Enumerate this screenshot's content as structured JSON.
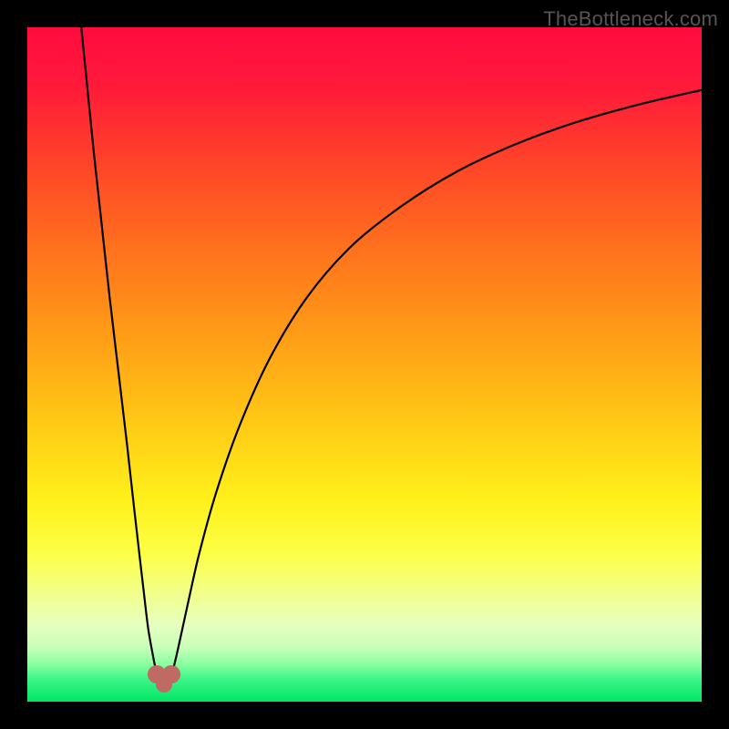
{
  "watermark": {
    "text": "TheBottleneck.com"
  },
  "chart_data": {
    "type": "line",
    "title": "",
    "xlabel": "",
    "ylabel": "",
    "xlim": [
      0,
      100
    ],
    "ylim": [
      0,
      100
    ],
    "grid": false,
    "legend": false,
    "gradient_stops": [
      {
        "offset": 0.0,
        "color": "#ff0b3f"
      },
      {
        "offset": 0.09,
        "color": "#ff1b3a"
      },
      {
        "offset": 0.2,
        "color": "#ff4329"
      },
      {
        "offset": 0.32,
        "color": "#ff6e1e"
      },
      {
        "offset": 0.45,
        "color": "#ff9a17"
      },
      {
        "offset": 0.58,
        "color": "#ffc716"
      },
      {
        "offset": 0.7,
        "color": "#fff01a"
      },
      {
        "offset": 0.78,
        "color": "#fcff47"
      },
      {
        "offset": 0.84,
        "color": "#f2ff8c"
      },
      {
        "offset": 0.885,
        "color": "#e7ffbf"
      },
      {
        "offset": 0.92,
        "color": "#c7ffb8"
      },
      {
        "offset": 0.945,
        "color": "#88ff9f"
      },
      {
        "offset": 0.965,
        "color": "#40f58a"
      },
      {
        "offset": 1.0,
        "color": "#00e765"
      }
    ],
    "series": [
      {
        "name": "left-branch",
        "x": [
          8.0,
          8.8,
          9.8,
          11.0,
          12.2,
          13.5,
          14.8,
          15.8,
          16.6,
          17.3,
          17.9,
          18.5,
          19.0,
          19.4
        ],
        "y": [
          100,
          92,
          82,
          71,
          60,
          49,
          38,
          29,
          22,
          16,
          11,
          7.5,
          5.0,
          3.6
        ]
      },
      {
        "name": "right-branch",
        "x": [
          21.2,
          21.8,
          22.6,
          23.8,
          25.5,
          28.0,
          31.5,
          36.0,
          41.5,
          48.0,
          55.5,
          63.5,
          72.0,
          81.0,
          90.5,
          100.0
        ],
        "y": [
          3.6,
          5.5,
          9.0,
          14.5,
          22.0,
          31.0,
          41.0,
          51.0,
          60.0,
          67.5,
          73.5,
          78.5,
          82.5,
          85.8,
          88.5,
          90.7
        ]
      },
      {
        "name": "dip-arc",
        "x": [
          19.4,
          19.6,
          19.9,
          20.3,
          20.7,
          21.0,
          21.2
        ],
        "y": [
          3.6,
          2.9,
          2.55,
          2.5,
          2.6,
          3.0,
          3.6
        ]
      }
    ],
    "markers": [
      {
        "name": "dip-left-marker",
        "x": 19.2,
        "y": 4.0,
        "r": 10,
        "color": "#bf6a63"
      },
      {
        "name": "dip-right-marker",
        "x": 21.3,
        "y": 4.1,
        "r": 10,
        "color": "#bf6a63"
      },
      {
        "name": "dip-bottom-marker",
        "x": 20.3,
        "y": 2.55,
        "r": 9,
        "color": "#bf6a63"
      }
    ],
    "line_style": {
      "stroke": "#000000",
      "width": 2.2
    }
  }
}
